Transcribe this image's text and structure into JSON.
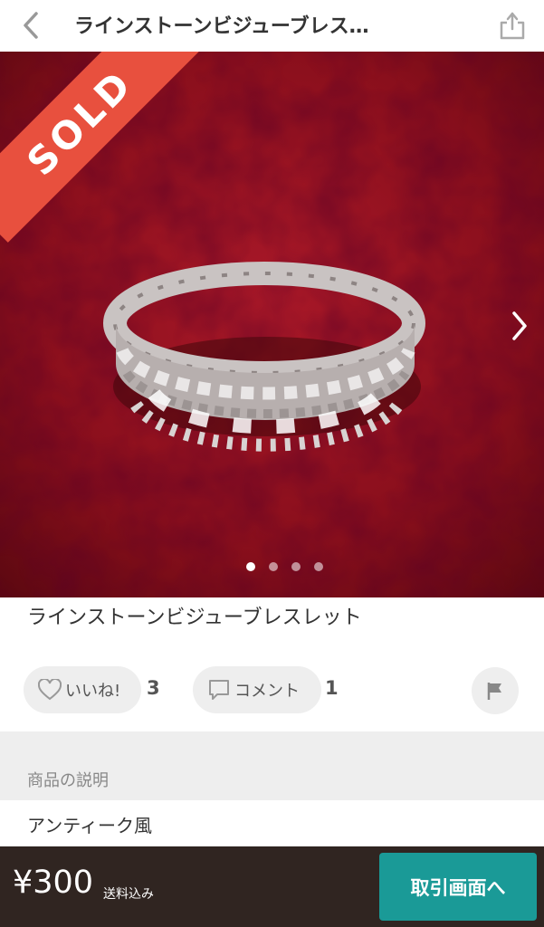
{
  "header": {
    "title": "ラインストーンビジューブレス…",
    "back_icon": "chevron-left-icon",
    "share_icon": "share-icon"
  },
  "hero": {
    "sold_label": "SOLD",
    "image_count": 4,
    "current_image": 1,
    "next_icon": "chevron-right-icon"
  },
  "item": {
    "name": "ラインストーンビジューブレスレット"
  },
  "actions": {
    "like_label": "いいね!",
    "like_count": "3",
    "comment_label": "コメント",
    "comment_count": "1",
    "flag_icon": "flag-icon"
  },
  "description": {
    "heading": "商品の説明",
    "body": "アンティーク風"
  },
  "footer": {
    "price": "¥300",
    "shipping": "送料込み",
    "trade_button": "取引画面へ"
  },
  "colors": {
    "sold_banner": "#e8503e",
    "footer_bg": "#302521",
    "trade_button": "#1a9a97",
    "velvet": "#8a0f1c"
  }
}
